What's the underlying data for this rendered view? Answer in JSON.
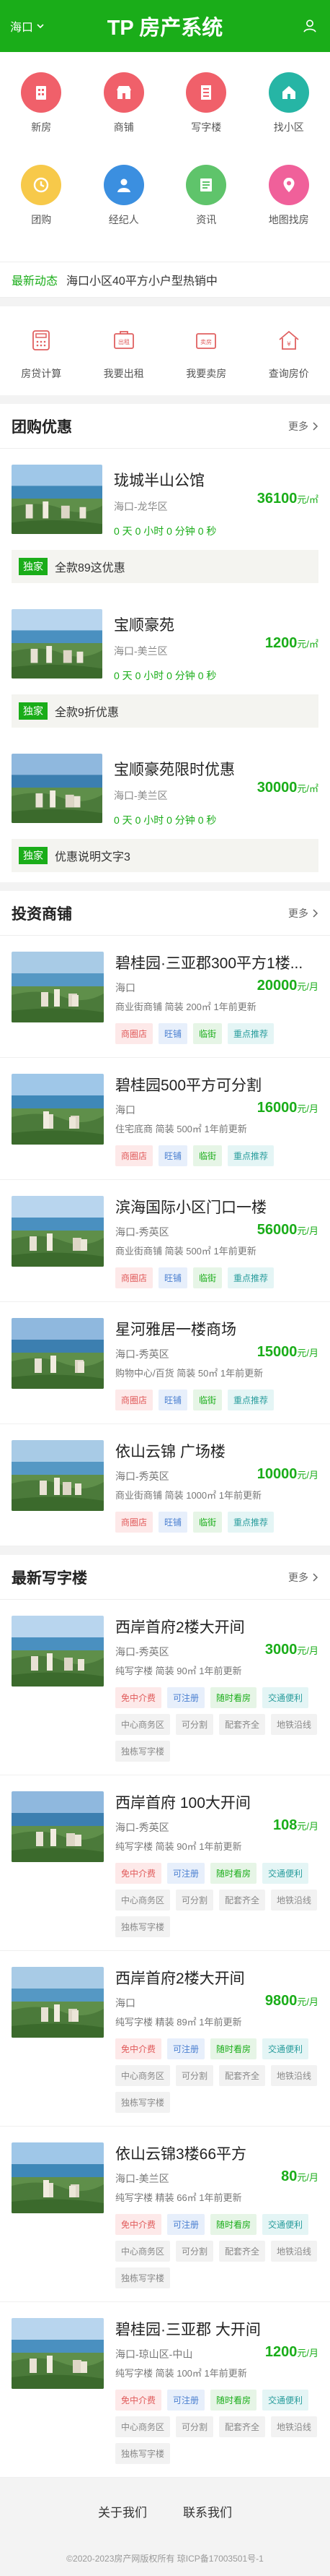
{
  "header": {
    "city": "海口",
    "title": "TP 房产系统"
  },
  "nav": [
    {
      "label": "新房",
      "icon": "building-icon",
      "color": "#f0606a"
    },
    {
      "label": "商铺",
      "icon": "shop-icon",
      "color": "#f0606a"
    },
    {
      "label": "写字楼",
      "icon": "office-icon",
      "color": "#f0606a"
    },
    {
      "label": "找小区",
      "icon": "community-icon",
      "color": "#26b5a5"
    },
    {
      "label": "团购",
      "icon": "clock-icon",
      "color": "#f7c94a"
    },
    {
      "label": "经纪人",
      "icon": "person-icon",
      "color": "#3b8fe0"
    },
    {
      "label": "资讯",
      "icon": "news-icon",
      "color": "#5fc46b"
    },
    {
      "label": "地图找房",
      "icon": "map-pin-icon",
      "color": "#f0609a"
    }
  ],
  "news": {
    "tag": "最新动态",
    "text": "海口小区40平方小户型热销中"
  },
  "tools": [
    {
      "label": "房贷计算",
      "icon": "calculator-icon"
    },
    {
      "label": "我要出租",
      "icon": "rent-icon"
    },
    {
      "label": "我要卖房",
      "icon": "sell-icon"
    },
    {
      "label": "查询房价",
      "icon": "house-price-icon"
    }
  ],
  "groupbuy": {
    "title": "团购优惠",
    "more": "更多",
    "items": [
      {
        "name": "珑城半山公馆",
        "area": "海口-龙华区",
        "price": "36100",
        "unit": "元/㎡",
        "countdown": "0 天 0 小时 0 分钟 0 秒",
        "badge": "独家",
        "note": "全款89这优惠"
      },
      {
        "name": "宝顺豪苑",
        "area": "海口-美兰区",
        "price": "1200",
        "unit": "元/㎡",
        "countdown": "0 天 0 小时 0 分钟 0 秒",
        "badge": "独家",
        "note": "全款9折优惠"
      },
      {
        "name": "宝顺豪苑限时优惠",
        "area": "海口-美兰区",
        "price": "30000",
        "unit": "元/㎡",
        "countdown": "0 天 0 小时 0 分钟 0 秒",
        "badge": "独家",
        "note": "优惠说明文字3"
      }
    ]
  },
  "shops": {
    "title": "投资商铺",
    "more": "更多",
    "items": [
      {
        "name": "碧桂园·三亚郡300平方1楼...",
        "area": "海口",
        "spec": "商业街商铺 简装 200㎡ 1年前更新",
        "price": "20000",
        "unit": "元/月",
        "tags": [
          "商圈店",
          "旺铺",
          "临街",
          "重点推荐"
        ]
      },
      {
        "name": "碧桂园500平方可分割",
        "area": "海口",
        "spec": "住宅底商 简装 500㎡ 1年前更新",
        "price": "16000",
        "unit": "元/月",
        "tags": [
          "商圈店",
          "旺铺",
          "临街",
          "重点推荐"
        ]
      },
      {
        "name": "滨海国际小区门口一楼",
        "area": "海口-秀英区",
        "spec": "商业街商铺 简装 500㎡ 1年前更新",
        "price": "56000",
        "unit": "元/月",
        "tags": [
          "商圈店",
          "旺铺",
          "临街",
          "重点推荐"
        ]
      },
      {
        "name": "星河雅居一楼商场",
        "area": "海口-秀英区",
        "spec": "购物中心/百货 简装 50㎡ 1年前更新",
        "price": "15000",
        "unit": "元/月",
        "tags": [
          "商圈店",
          "旺铺",
          "临街",
          "重点推荐"
        ]
      },
      {
        "name": "依山云锦 广场楼",
        "area": "海口-秀英区",
        "spec": "商业街商铺 简装 1000㎡ 1年前更新",
        "price": "10000",
        "unit": "元/月",
        "tags": [
          "商圈店",
          "旺铺",
          "临街",
          "重点推荐"
        ]
      }
    ]
  },
  "offices": {
    "title": "最新写字楼",
    "more": "更多",
    "items": [
      {
        "name": "西岸首府2楼大开间",
        "area": "海口-秀英区",
        "spec": "纯写字楼 简装 90㎡ 1年前更新",
        "price": "3000",
        "unit": "元/月",
        "tags": [
          "免中介费",
          "可注册",
          "随时看房",
          "交通便利",
          "中心商务区",
          "可分割",
          "配套齐全",
          "地铁沿线",
          "独栋写字楼"
        ]
      },
      {
        "name": "西岸首府 100大开间",
        "area": "海口-秀英区",
        "spec": "纯写字楼 简装 90㎡ 1年前更新",
        "price": "108",
        "unit": "元/月",
        "tags": [
          "免中介费",
          "可注册",
          "随时看房",
          "交通便利",
          "中心商务区",
          "可分割",
          "配套齐全",
          "地铁沿线",
          "独栋写字楼"
        ]
      },
      {
        "name": "西岸首府2楼大开间",
        "area": "海口",
        "spec": "纯写字楼 精装 89㎡ 1年前更新",
        "price": "9800",
        "unit": "元/月",
        "tags": [
          "免中介费",
          "可注册",
          "随时看房",
          "交通便利",
          "中心商务区",
          "可分割",
          "配套齐全",
          "地铁沿线",
          "独栋写字楼"
        ]
      },
      {
        "name": "依山云锦3楼66平方",
        "area": "海口-美兰区",
        "spec": "纯写字楼 精装 66㎡ 1年前更新",
        "price": "80",
        "unit": "元/月",
        "tags": [
          "免中介费",
          "可注册",
          "随时看房",
          "交通便利",
          "中心商务区",
          "可分割",
          "配套齐全",
          "地铁沿线",
          "独栋写字楼"
        ]
      },
      {
        "name": "碧桂园·三亚郡 大开间",
        "area": "海口-琼山区-中山",
        "spec": "纯写字楼 简装 100㎡ 1年前更新",
        "price": "1200",
        "unit": "元/月",
        "tags": [
          "免中介费",
          "可注册",
          "随时看房",
          "交通便利",
          "中心商务区",
          "可分割",
          "配套齐全",
          "地铁沿线",
          "独栋写字楼"
        ]
      }
    ]
  },
  "footer": {
    "about": "关于我们",
    "contact": "联系我们",
    "copyright": "©2020-2023房产网版权所有 琼ICP备17003501号-1"
  },
  "colors": {
    "brand": "#1aad19"
  }
}
